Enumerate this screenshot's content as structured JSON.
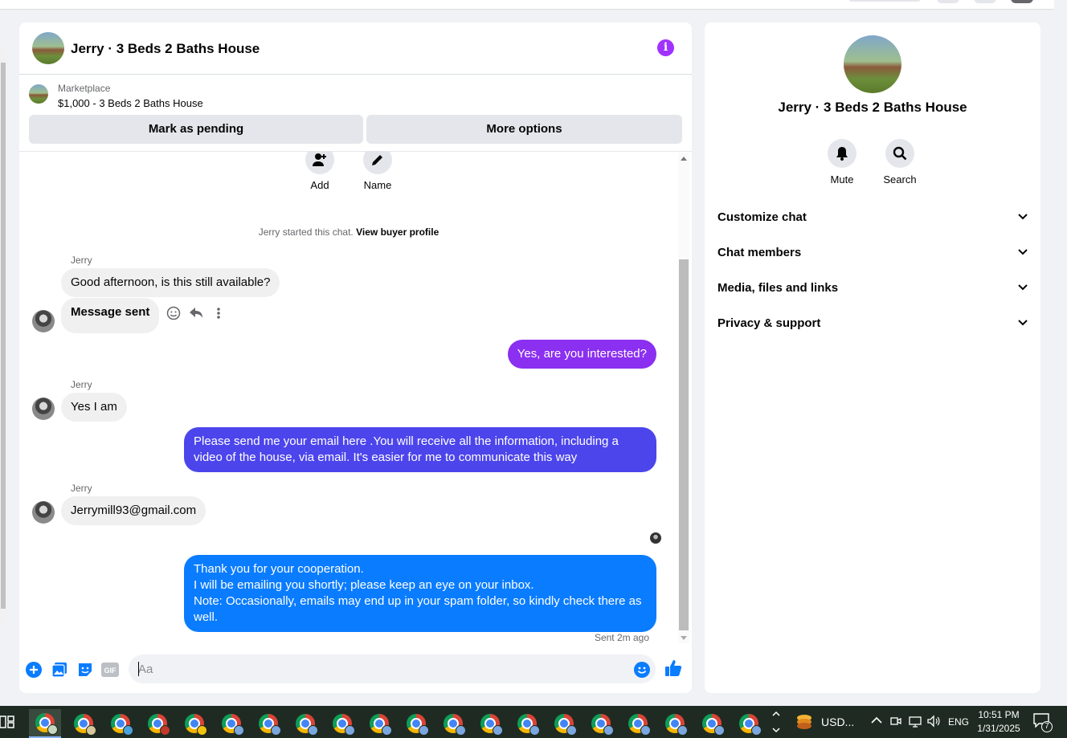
{
  "chat": {
    "title": "Jerry · 3 Beds 2 Baths House",
    "marketplace_label": "Marketplace",
    "listing": "$1,000 - 3 Beds 2 Baths House",
    "mark_pending": "Mark as pending",
    "more_options": "More options",
    "actions": {
      "add": "Add",
      "name": "Name"
    },
    "started_text": "Jerry started this chat.",
    "view_buyer_profile": "View buyer profile",
    "messages": [
      {
        "sender": "Jerry",
        "direction": "in",
        "text": "Good afternoon, is this still available?"
      },
      {
        "direction": "in",
        "text": "Message sent"
      },
      {
        "direction": "out",
        "text": "Yes, are you interested?",
        "color": "#8b2ff0"
      },
      {
        "sender": "Jerry",
        "direction": "in",
        "text": "Yes I am"
      },
      {
        "direction": "out",
        "text": "Please send me your email here .You will receive all the information, including a video of the house, via email. It's easier for me to communicate this way",
        "color": "#4c45ec"
      },
      {
        "sender": "Jerry",
        "direction": "in",
        "text": "Jerrymill93@gmail.com"
      },
      {
        "direction": "out",
        "text": "Thank you for your cooperation.\nI will be emailing you shortly; please keep an eye on your inbox.\nNote: Occasionally, emails may end up in your spam folder, so kindly check there as well.",
        "color": "#0a7cff"
      }
    ],
    "sent_status": "Sent 2m ago",
    "composer_placeholder": "Aa",
    "composer_value": ""
  },
  "details": {
    "title": "Jerry · 3 Beds 2 Baths House",
    "mute": "Mute",
    "search": "Search",
    "sections": [
      "Customize chat",
      "Chat members",
      "Media, files and links",
      "Privacy & support"
    ]
  },
  "taskbar": {
    "tray_app": "USD...",
    "language": "ENG",
    "time": "10:51 PM",
    "date": "1/31/2025",
    "notifications": "7"
  },
  "colors": {
    "accent": "#0084ff",
    "info": "#a033ff",
    "like": "#0a7cff"
  }
}
